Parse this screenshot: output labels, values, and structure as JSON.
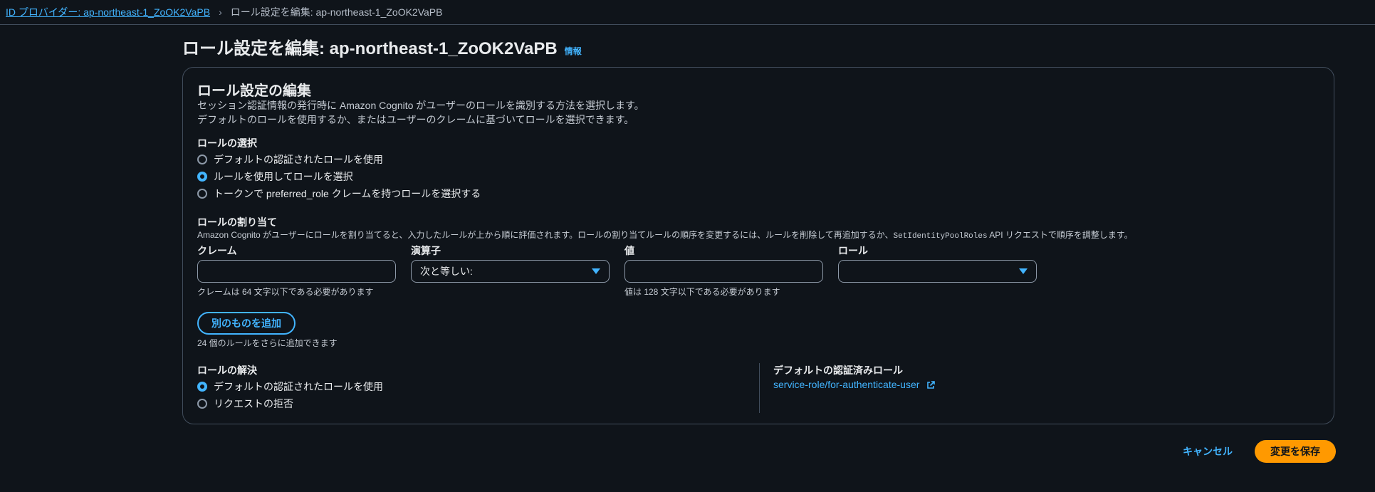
{
  "breadcrumb": {
    "parent": "ID プロバイダー: ap-northeast-1_ZoOK2VaPB",
    "separator": "›",
    "current": "ロール設定を編集: ap-northeast-1_ZoOK2VaPB"
  },
  "page": {
    "title": "ロール設定を編集: ap-northeast-1_ZoOK2VaPB",
    "info_link": "情報"
  },
  "panel": {
    "title": "ロール設定の編集",
    "description_line1": "セッション認証情報の発行時に Amazon Cognito がユーザーのロールを識別する方法を選択します。",
    "description_line2": "デフォルトのロールを使用するか、またはユーザーのクレームに基づいてロールを選択できます。"
  },
  "role_selection": {
    "label": "ロールの選択",
    "options": [
      {
        "label": "デフォルトの認証されたロールを使用",
        "checked": false
      },
      {
        "label": "ルールを使用してロールを選択",
        "checked": true
      },
      {
        "label": "トークンで preferred_role クレームを持つロールを選択する",
        "checked": false
      }
    ]
  },
  "role_assignment": {
    "label": "ロールの割り当て",
    "description_prefix": "Amazon Cognito がユーザーにロールを割り当てると、入力したルールが上から順に評価されます。ロールの割り当てルールの順序を変更するには、ルールを削除して再追加するか、",
    "description_api": "SetIdentityPoolRoles",
    "description_suffix": " API リクエストで順序を調整します。",
    "claim_label": "クレーム",
    "claim_value": "",
    "claim_hint": "クレームは 64 文字以下である必要があります",
    "operator_label": "演算子",
    "operator_value": "次と等しい:",
    "value_label": "値",
    "value_value": "",
    "value_hint": "値は 128 文字以下である必要があります",
    "role_label": "ロール",
    "role_value": "",
    "add_button": "別のものを追加",
    "remaining_text": "24 個のルールをさらに追加できます"
  },
  "role_resolution": {
    "label": "ロールの解決",
    "options": [
      {
        "label": "デフォルトの認証されたロールを使用",
        "checked": true
      },
      {
        "label": "リクエストの拒否",
        "checked": false
      }
    ]
  },
  "default_role": {
    "label": "デフォルトの認証済みロール",
    "link": "service-role/for-authenticate-user"
  },
  "footer": {
    "cancel": "キャンセル",
    "save": "変更を保存"
  },
  "colors": {
    "background": "#0f141a",
    "link": "#42b4ff",
    "primary_button": "#ff9900",
    "border": "#414d5c"
  }
}
